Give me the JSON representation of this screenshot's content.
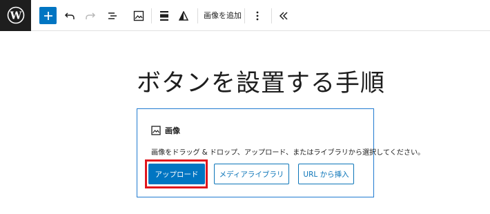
{
  "toolbar": {
    "logo": "wordpress-logo",
    "add_block": "plus-icon",
    "undo": "undo-icon",
    "redo": "redo-icon",
    "list_view": "list-view-icon",
    "image_tool": "image-icon",
    "align": "align-icon",
    "duotone": "duotone-icon",
    "add_image_label": "画像を追加",
    "more": "more-vertical-icon",
    "collapse": "chevron-double-left-icon"
  },
  "page": {
    "title": "ボタンを設置する手順"
  },
  "image_block": {
    "label": "画像",
    "instructions": "画像をドラッグ & ドロップ、アップロード、またはライブラリから選択してください。",
    "upload_button": "アップロード",
    "media_library_button": "メディアライブラリ",
    "url_button": "URL から挿入"
  },
  "colors": {
    "accent": "#0075c2",
    "highlight": "#e0141c",
    "dark": "#1e1e1e"
  }
}
